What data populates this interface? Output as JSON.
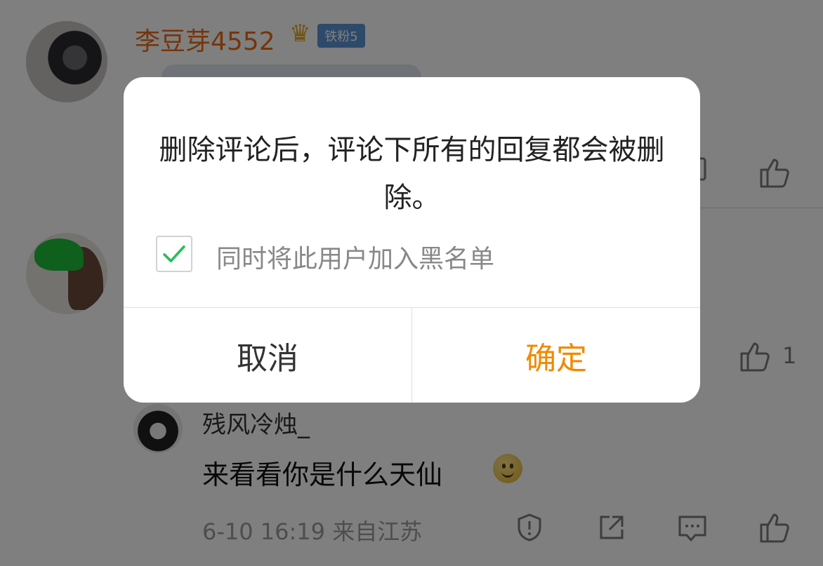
{
  "comments": [
    {
      "username": "李豆芽4552",
      "badge": "铁粉5",
      "crown_icon": "♛"
    },
    {},
    {
      "username": "残风冷烛_",
      "text": "来看看你是什么天仙",
      "meta": "6-10 16:19  来自江苏"
    }
  ],
  "like_count": "1",
  "dialog": {
    "message": "删除评论后，评论下所有的回复都会被删除。",
    "checkbox_label": "同时将此用户加入黑名单",
    "checkbox_checked": true,
    "cancel_label": "取消",
    "confirm_label": "确定"
  },
  "colors": {
    "username_orange": "#ea6b16",
    "confirm_orange": "#f08a00",
    "check_green": "#2bbd5a",
    "badge_blue": "#5d95d6",
    "overlay": "rgba(0,0,0,0.5)"
  },
  "icons": [
    "like-icon",
    "reply-icon",
    "report-icon",
    "share-icon",
    "comment-icon",
    "crown-icon",
    "check-icon",
    "smile-emoji"
  ]
}
